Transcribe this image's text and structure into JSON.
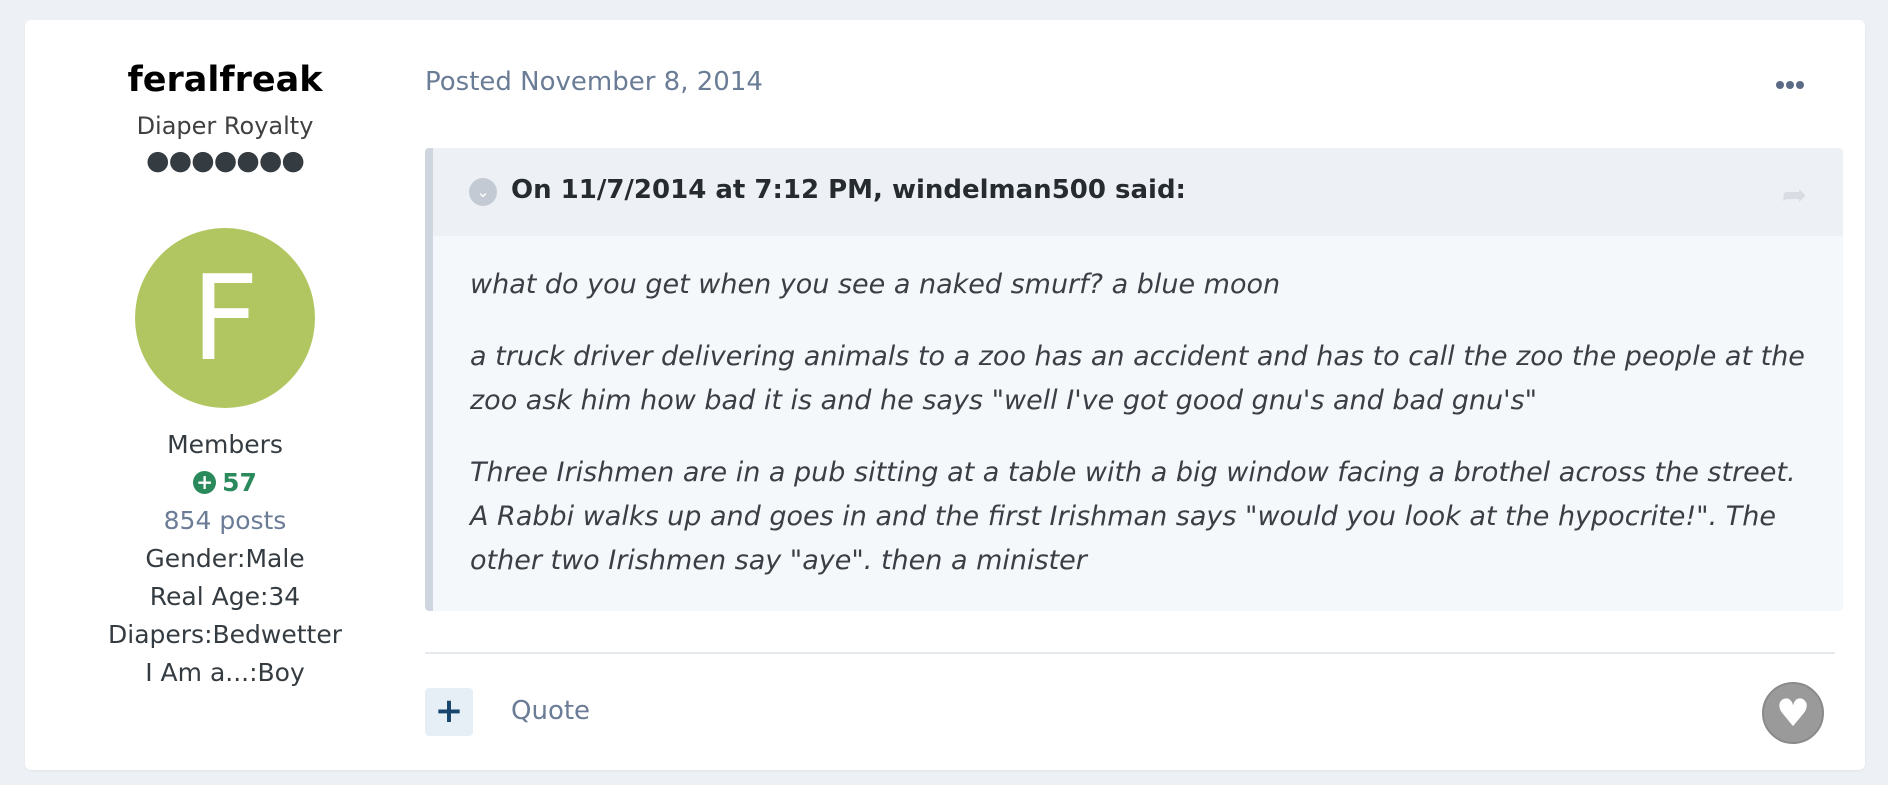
{
  "author": {
    "username": "feralfreak",
    "title": "Diaper Royalty",
    "rank_pips": "●●●●●●●",
    "avatar_letter": "F",
    "avatar_color": "#b1c661",
    "group": "Members",
    "reputation": "57",
    "posts": "854 posts",
    "fields": [
      "Gender:Male",
      "Real Age:34",
      "Diapers:Bedwetter",
      "I Am a...:Boy"
    ]
  },
  "post": {
    "meta": "Posted November 8, 2014",
    "quote": {
      "citation": "On 11/7/2014 at 7:12 PM, windelman500 said:",
      "paragraphs": [
        "what do you get when you see a naked smurf? a blue moon",
        "a truck driver delivering animals to a zoo has an accident and has to call the zoo the people at the zoo ask him how bad it is and he says \"well I've got good gnu's and bad gnu's\"",
        "Three Irishmen are in a pub sitting at a table with a big window facing a brothel across the street. A Rabbi walks up and goes in and the first Irishman says \"would you look at the hypocrite!\". The other two Irishmen say \"aye\". then a minister"
      ]
    }
  },
  "actions": {
    "plus_label": "+",
    "quote_label": "Quote"
  },
  "icons": {
    "more": "ellipsis-icon",
    "toggle": "chevron-down-icon",
    "share": "share-arrow-icon",
    "like": "heart-icon",
    "rep": "plus-circle-icon"
  },
  "colors": {
    "accent": "#17456d",
    "reputation": "#2a8a5c",
    "meta": "#6b7c96"
  }
}
